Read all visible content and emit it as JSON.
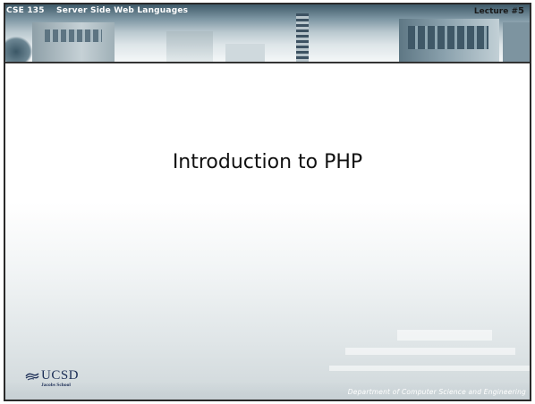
{
  "header": {
    "course": "CSE 135    Server Side Web Languages",
    "lecture_label": "Lecture #",
    "lecture_number": "5"
  },
  "slide": {
    "title": "Introduction to PHP"
  },
  "logo": {
    "name": "UCSD",
    "subtitle": "Jacobs School"
  },
  "footer": {
    "department": "Department of Computer Science and Engineering"
  },
  "colors": {
    "border": "#2a2a2a",
    "logo_blue": "#1b2d55",
    "header_dark": "#3f5a69"
  }
}
